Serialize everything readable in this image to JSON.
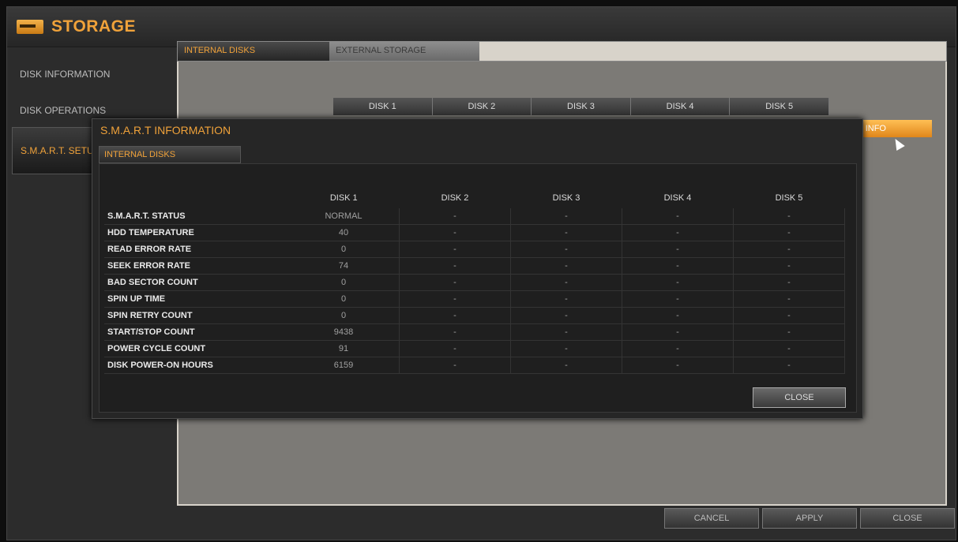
{
  "app": {
    "title": "STORAGE"
  },
  "sidebar": {
    "items": [
      {
        "label": "DISK INFORMATION"
      },
      {
        "label": "DISK OPERATIONS"
      },
      {
        "label": "S.M.A.R.T. SETUP"
      }
    ]
  },
  "main": {
    "tabs": [
      {
        "label": "INTERNAL DISKS"
      },
      {
        "label": "EXTERNAL STORAGE"
      }
    ],
    "disk_headers": [
      "DISK 1",
      "DISK 2",
      "DISK 3",
      "DISK 4",
      "DISK 5"
    ],
    "detail_button": "DETAIL INFO"
  },
  "footer": {
    "cancel": "CANCEL",
    "apply": "APPLY",
    "close": "CLOSE"
  },
  "modal": {
    "title": "S.M.A.R.T INFORMATION",
    "tab": "INTERNAL DISKS",
    "columns": [
      "DISK 1",
      "DISK 2",
      "DISK 3",
      "DISK 4",
      "DISK 5"
    ],
    "rows": [
      {
        "label": "S.M.A.R.T. STATUS",
        "values": [
          "NORMAL",
          "-",
          "-",
          "-",
          "-"
        ]
      },
      {
        "label": "HDD TEMPERATURE",
        "values": [
          "40",
          "-",
          "-",
          "-",
          "-"
        ]
      },
      {
        "label": "READ ERROR RATE",
        "values": [
          "0",
          "-",
          "-",
          "-",
          "-"
        ]
      },
      {
        "label": "SEEK ERROR RATE",
        "values": [
          "74",
          "-",
          "-",
          "-",
          "-"
        ]
      },
      {
        "label": "BAD SECTOR COUNT",
        "values": [
          "0",
          "-",
          "-",
          "-",
          "-"
        ]
      },
      {
        "label": "SPIN UP TIME",
        "values": [
          "0",
          "-",
          "-",
          "-",
          "-"
        ]
      },
      {
        "label": "SPIN RETRY COUNT",
        "values": [
          "0",
          "-",
          "-",
          "-",
          "-"
        ]
      },
      {
        "label": "START/STOP COUNT",
        "values": [
          "9438",
          "-",
          "-",
          "-",
          "-"
        ]
      },
      {
        "label": "POWER CYCLE COUNT",
        "values": [
          "91",
          "-",
          "-",
          "-",
          "-"
        ]
      },
      {
        "label": "DISK POWER-ON HOURS",
        "values": [
          "6159",
          "-",
          "-",
          "-",
          "-"
        ]
      }
    ],
    "close_button": "CLOSE"
  }
}
